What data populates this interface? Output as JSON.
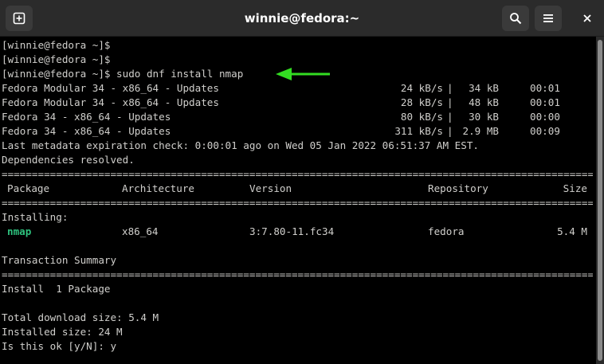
{
  "window": {
    "title": "winnie@fedora:~",
    "icons": {
      "new_tab": "new-tab-icon",
      "search": "search-icon",
      "menu": "hamburger-menu-icon",
      "close": "close-icon"
    }
  },
  "terminal": {
    "prompts": [
      "[winnie@fedora ~]$",
      "[winnie@fedora ~]$",
      "[winnie@fedora ~]$ sudo dnf install nmap"
    ],
    "repos": [
      {
        "name": "Fedora Modular 34 - x86_64 - Updates",
        "speed": "24 kB/s",
        "size": "34 kB",
        "time": "00:01"
      },
      {
        "name": "Fedora Modular 34 - x86_64 - Updates",
        "speed": "28 kB/s",
        "size": "48 kB",
        "time": "00:01"
      },
      {
        "name": "Fedora 34 - x86_64 - Updates",
        "speed": "80 kB/s",
        "size": "30 kB",
        "time": "00:00"
      },
      {
        "name": "Fedora 34 - x86_64 - Updates",
        "speed": "311 kB/s",
        "size": "2.9 MB",
        "time": "00:09"
      }
    ],
    "sep": "|",
    "metadata_line": "Last metadata expiration check: 0:00:01 ago on Wed 05 Jan 2022 06:51:37 AM EST.",
    "deps_line": "Dependencies resolved.",
    "rule": "================================================================================================================================",
    "table_headers": {
      "package": "Package",
      "arch": "Architecture",
      "version": "Version",
      "repository": "Repository",
      "size": "Size"
    },
    "installing_label": "Installing:",
    "package": {
      "name": "nmap",
      "arch": "x86_64",
      "version": "3:7.80-11.fc34",
      "repository": "fedora",
      "size": "5.4 M"
    },
    "summary_title": "Transaction Summary",
    "install_line": "Install  1 Package",
    "download_size": "Total download size: 5.4 M",
    "installed_size": "Installed size: 24 M",
    "confirm_prompt": "Is this ok [y/N]: y"
  },
  "colors": {
    "background": "#000000",
    "text": "#d0cfcc",
    "package_name": "#2ec27e",
    "arrow": "#33dd22",
    "titlebar": "#2b2b2b"
  },
  "annotation": {
    "arrow_icon": "left-arrow-icon"
  }
}
